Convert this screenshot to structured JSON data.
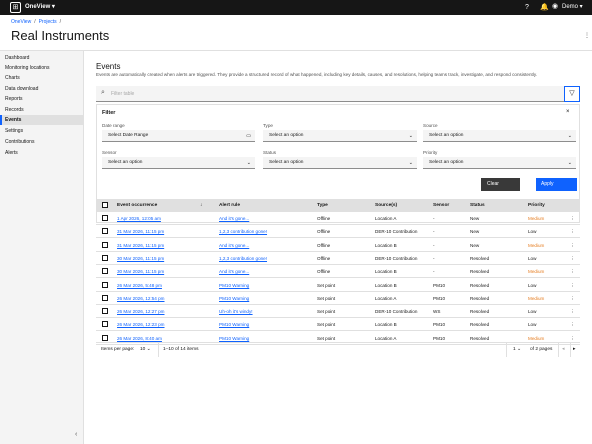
{
  "app": {
    "name": "OneView",
    "user": "Demo"
  },
  "breadcrumb": [
    "OneView",
    "Projects"
  ],
  "page_title": "Real Instruments",
  "sidebar": {
    "items": [
      "Dashboard",
      "Monitoring locations",
      "Charts",
      "Data download",
      "Reports",
      "Records",
      "Events",
      "Settings",
      "Contributions",
      "Alerts"
    ],
    "active": "Events"
  },
  "events": {
    "title": "Events",
    "description": "Events are automatically created when alerts are triggered. They provide a structured record of what happened, including key details, causes, and resolutions, helping teams track, investigate, and respond consistently."
  },
  "search": {
    "placeholder": "Filter table"
  },
  "filter": {
    "title": "Filter",
    "date_range": {
      "label": "Date range",
      "value": "Select Date Range"
    },
    "type": {
      "label": "Type",
      "value": "Select an option"
    },
    "source": {
      "label": "Source",
      "value": "Select an option"
    },
    "sensor": {
      "label": "Sensor",
      "value": "Select an option"
    },
    "status": {
      "label": "Status",
      "value": "Select an option"
    },
    "priority": {
      "label": "Priority",
      "value": "Select an option"
    },
    "clear_label": "Clear",
    "apply_label": "Apply"
  },
  "table": {
    "headers": [
      "Event occurrence",
      "Alert rule",
      "Type",
      "Source(s)",
      "Sensor",
      "Status",
      "Priority"
    ],
    "rows": [
      {
        "occ": "1 Apr 2026, 12:05 am",
        "rule": "And it's gone...",
        "type": "Offline",
        "source": "Location A",
        "sensor": "-",
        "status": "New",
        "priority": "Medium"
      },
      {
        "occ": "31 Mar 2026, 11:15 pm",
        "rule": "1,2,3 contribution gone!",
        "type": "Offline",
        "source": "DER-10 Contribution",
        "sensor": "-",
        "status": "New",
        "priority": "Low"
      },
      {
        "occ": "31 Mar 2026, 11:15 pm",
        "rule": "And it's gone...",
        "type": "Offline",
        "source": "Location B",
        "sensor": "-",
        "status": "New",
        "priority": "Medium"
      },
      {
        "occ": "30 Mar 2026, 11:15 pm",
        "rule": "1,2,3 contribution gone!",
        "type": "Offline",
        "source": "DER-10 Contribution",
        "sensor": "-",
        "status": "Resolved",
        "priority": "Low"
      },
      {
        "occ": "30 Mar 2026, 11:15 pm",
        "rule": "And it's gone...",
        "type": "Offline",
        "source": "Location B",
        "sensor": "-",
        "status": "Resolved",
        "priority": "Medium"
      },
      {
        "occ": "26 Mar 2026, 5:48 pm",
        "rule": "PM10 Warning",
        "type": "Set point",
        "source": "Location B",
        "sensor": "PM10",
        "status": "Resolved",
        "priority": "Low"
      },
      {
        "occ": "26 Mar 2026, 12:54 pm",
        "rule": "PM10 Warning",
        "type": "Set point",
        "source": "Location A",
        "sensor": "PM10",
        "status": "Resolved",
        "priority": "Medium"
      },
      {
        "occ": "26 Mar 2026, 12:27 pm",
        "rule": "Uh-oh it's windy!",
        "type": "Set point",
        "source": "DER-10 Contribution",
        "sensor": "WS",
        "status": "Resolved",
        "priority": "Low"
      },
      {
        "occ": "26 Mar 2026, 12:23 pm",
        "rule": "PM10 Warning",
        "type": "Set point",
        "source": "Location B",
        "sensor": "PM10",
        "status": "Resolved",
        "priority": "Low"
      },
      {
        "occ": "26 Mar 2026, 8:40 am",
        "rule": "PM10 Warning",
        "type": "Set point",
        "source": "Location A",
        "sensor": "PM10",
        "status": "Resolved",
        "priority": "Medium"
      }
    ]
  },
  "pagination": {
    "items_per_page_label": "Items per page:",
    "items_per_page": "10",
    "range": "1–10 of 14 items",
    "page": "1",
    "of_pages": "of 2 pages"
  },
  "colors": {
    "accent": "#0f62fe",
    "topbar": "#161616",
    "medium": "#e67e22"
  }
}
